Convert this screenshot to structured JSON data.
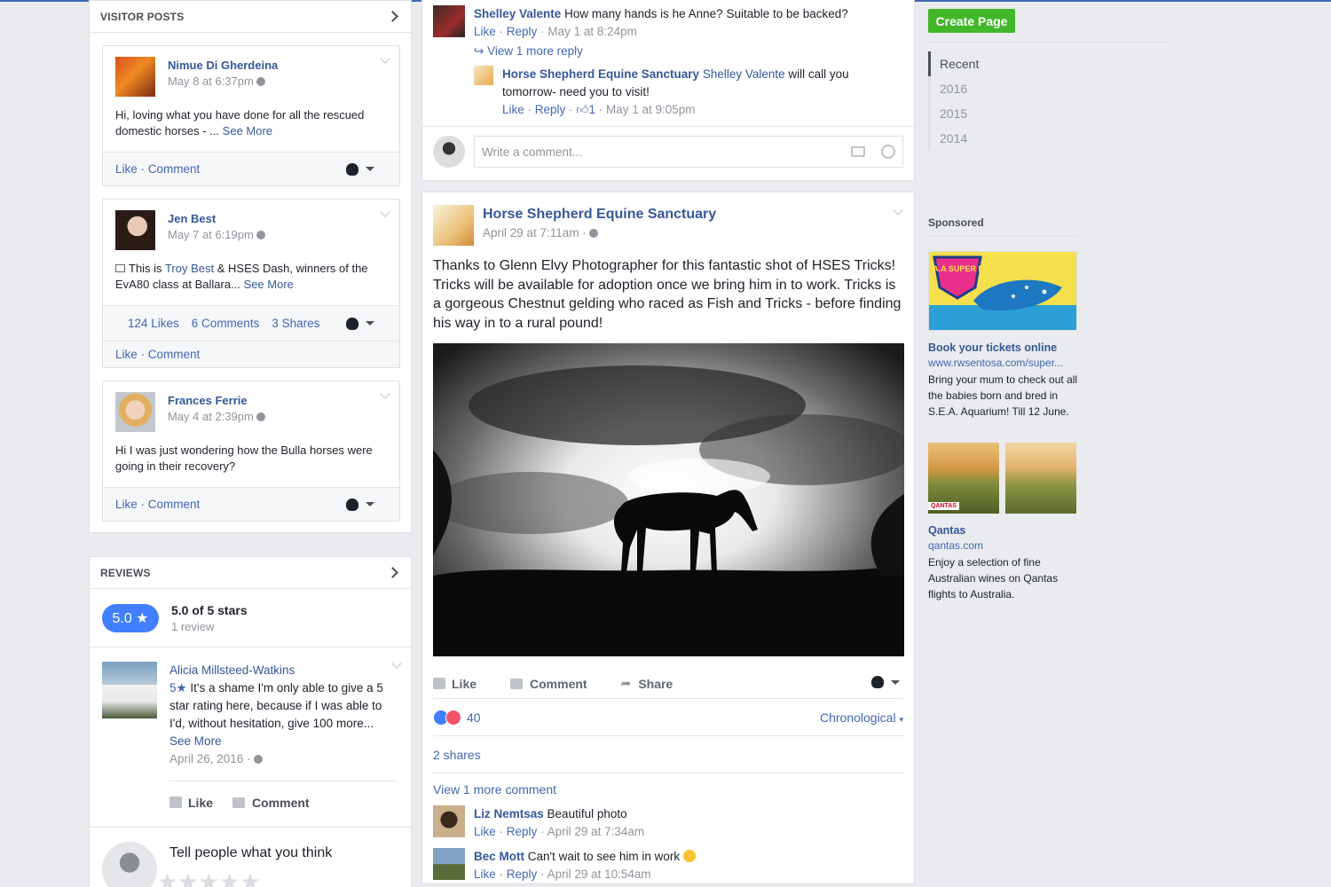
{
  "visitor_posts": {
    "title": "VISITOR POSTS",
    "posts": [
      {
        "name": "Nimue Di Gherdeina",
        "time": "May 8 at 6:37pm",
        "text": "Hi, loving what you have done for all the rescued domestic horses - ...",
        "see_more": "See More",
        "like": "Like",
        "comment": "Comment"
      },
      {
        "name": "Jen Best",
        "time": "May 7 at 6:19pm",
        "text_prefix": "This is",
        "tag1": "Troy Best",
        "text_mid": "& HSES Dash, winners of the EvA80 class at Ballara...",
        "see_more": "See More",
        "likes": "124 Likes",
        "comments": "6 Comments",
        "shares": "3 Shares",
        "like": "Like",
        "comment": "Comment"
      },
      {
        "name": "Frances Ferrie",
        "time": "May 4 at 2:39pm",
        "text": "Hi I was just wondering how the Bulla horses were going in their recovery?",
        "like": "Like",
        "comment": "Comment"
      }
    ]
  },
  "reviews": {
    "title": "REVIEWS",
    "score": "5.0 ★",
    "summary": "5.0 of 5 stars",
    "count": "1 review",
    "review": {
      "name": "Alicia Millsteed-Watkins",
      "stars": "5★",
      "text": "It's a shame I'm only able to give a 5 star rating here, because if I was able to I'd, without hesitation, give 100 more...",
      "see_more": "See More",
      "date": "April 26, 2016 ·",
      "like": "Like",
      "comment": "Comment"
    },
    "prompt": "Tell people what you think",
    "stars_empty": "★★★★★"
  },
  "center": {
    "top_comment": {
      "name": "Shelley Valente",
      "text": "How many hands is he Anne? Suitable to be backed?",
      "like": "Like",
      "reply": "Reply",
      "time": "May 1 at 8:24pm",
      "view_reply": "View 1 more reply"
    },
    "reply": {
      "name": "Horse Shepherd Equine Sanctuary",
      "tag": "Shelley Valente",
      "text": "will call you tomorrow- need you to visit!",
      "like": "Like",
      "reply": "Reply",
      "likes": "1",
      "time": "May 1 at 9:05pm"
    },
    "write_placeholder": "Write a comment...",
    "post": {
      "page": "Horse Shepherd Equine Sanctuary",
      "time": "April 29 at 7:11am ·",
      "text": "Thanks to Glenn Elvy Photographer for this fantastic shot of HSES Tricks! Tricks will be available for adoption once we bring him in to work. Tricks is a gorgeous Chestnut gelding who raced as Fish and Tricks - before finding his way in to a rural pound!",
      "like": "Like",
      "comment": "Comment",
      "share": "Share",
      "reactions": "40",
      "order": "Chronological",
      "shares": "2 shares",
      "view_more": "View 1 more comment",
      "comments": [
        {
          "name": "Liz Nemtsas",
          "text": "Beautiful photo",
          "like": "Like",
          "reply": "Reply",
          "time": "April 29 at 7:34am"
        },
        {
          "name": "Bec Mott",
          "text": "Can't wait to see him in work",
          "like": "Like",
          "reply": "Reply",
          "time": "April 29 at 10:54am"
        }
      ]
    }
  },
  "right": {
    "create_page": "Create Page",
    "years": [
      "Recent",
      "2016",
      "2015",
      "2014"
    ],
    "sponsored": "Sponsored",
    "ads": [
      {
        "title": "Book your tickets online",
        "url": "www.rwsentosa.com/super...",
        "desc": "Bring your mum to check out all the babies born and bred in S.E.A. Aquarium! Till 12 June.",
        "image_text": "S.E.A.A SUPER MUM"
      },
      {
        "title": "Qantas",
        "url": "qantas.com",
        "desc": "Enjoy a selection of fine Australian wines on Qantas flights to Australia.",
        "image_text": "QANTAS"
      }
    ]
  },
  "colors": {
    "link": "#365899",
    "accent": "#4267b2",
    "create": "#42b72a",
    "pill": "#4080ff"
  }
}
